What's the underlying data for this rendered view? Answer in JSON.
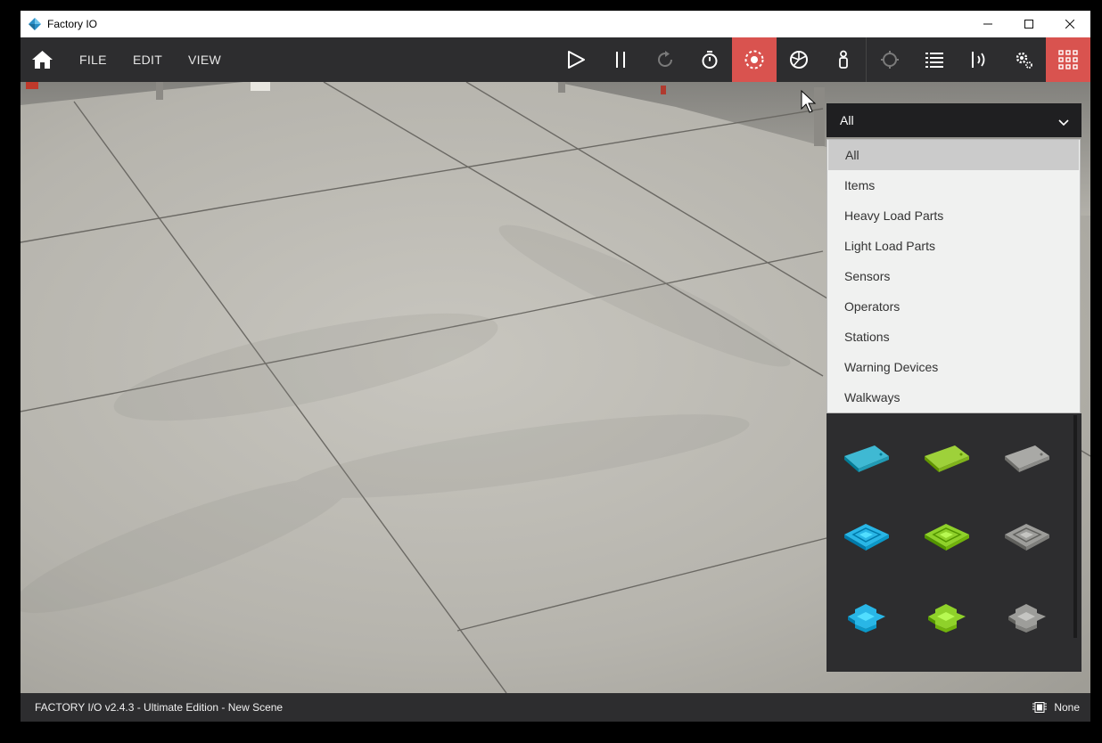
{
  "window": {
    "title": "Factory IO"
  },
  "menu": {
    "file": "FILE",
    "edit": "EDIT",
    "view": "VIEW"
  },
  "toolbar": {
    "icons": [
      "home-icon",
      "play-icon",
      "pause-icon",
      "reset-icon",
      "timer-icon",
      "camera-orbit-icon",
      "camera-fly-icon",
      "camera-first-person-icon",
      "crosshair-icon",
      "list-icon",
      "sensor-icon",
      "settings-icon",
      "palette-grid-icon"
    ],
    "active_color": "#d9534f"
  },
  "dropdown": {
    "selected": "All",
    "options": [
      "All",
      "Items",
      "Heavy Load Parts",
      "Light Load Parts",
      "Sensors",
      "Operators",
      "Stations",
      "Warning Devices",
      "Walkways"
    ]
  },
  "palette": {
    "tiles": [
      {
        "name": "blue-flat-plate",
        "color": "#3fb9d3"
      },
      {
        "name": "green-flat-plate",
        "color": "#9ed13a"
      },
      {
        "name": "grey-flat-plate",
        "color": "#a9a9a6"
      },
      {
        "name": "blue-square-pad",
        "color": "#29b6e6"
      },
      {
        "name": "green-square-pad",
        "color": "#8fd12a"
      },
      {
        "name": "grey-square-pad",
        "color": "#9d9d9a"
      },
      {
        "name": "blue-cross-pad",
        "color": "#29b6e6"
      },
      {
        "name": "green-cross-pad",
        "color": "#8fd12a"
      },
      {
        "name": "grey-cross-pad",
        "color": "#9d9d9a"
      }
    ]
  },
  "status": {
    "text": "FACTORY I/O v2.4.3 - Ultimate Edition - New Scene",
    "right": "None"
  }
}
